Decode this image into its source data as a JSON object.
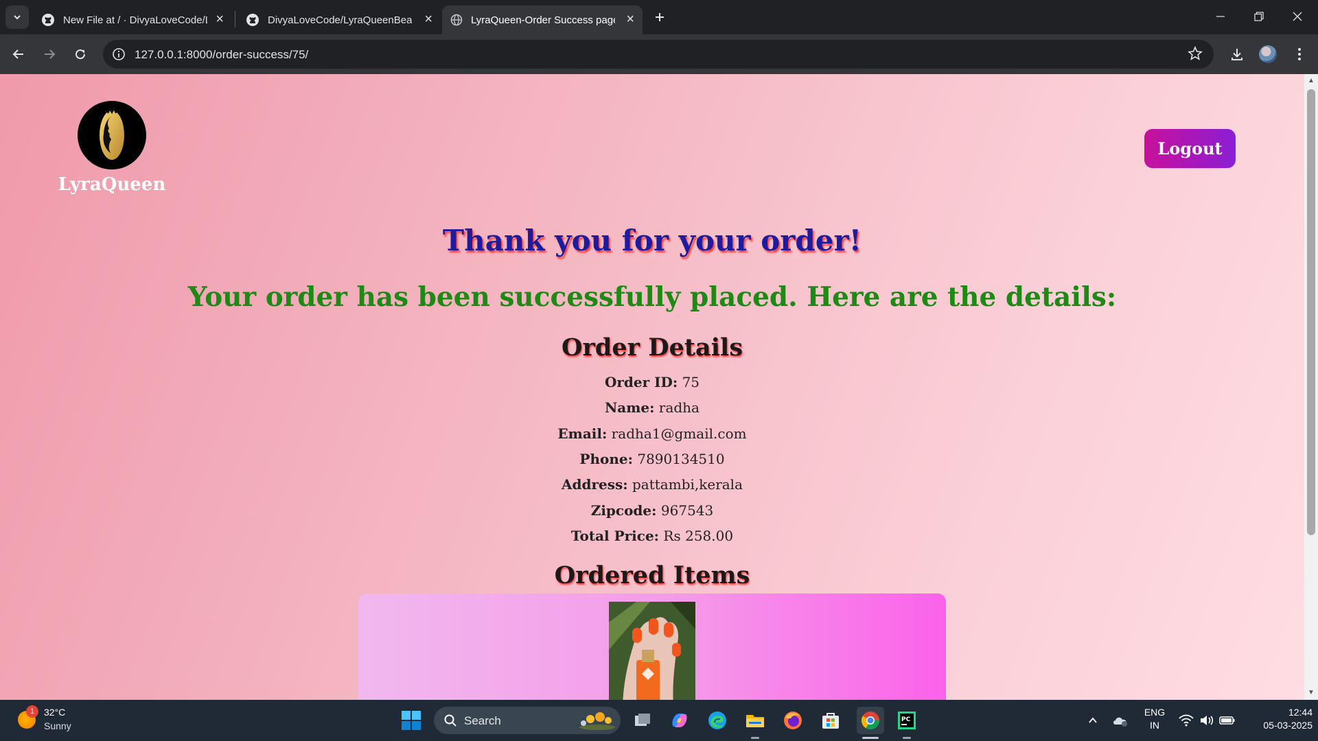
{
  "browser": {
    "tabs": [
      {
        "title": "New File at / · DivyaLoveCode/LyraQueenBeauty",
        "icon": "github-icon"
      },
      {
        "title": "DivyaLoveCode/LyraQueenBeauty",
        "icon": "github-icon"
      },
      {
        "title": "LyraQueen-Order Success page",
        "icon": "globe-icon",
        "active": true
      }
    ],
    "url": "127.0.0.1:8000/order-success/75/"
  },
  "page": {
    "brand": "LyraQueen",
    "logout_label": "Logout",
    "thank_you": "Thank you for your order!",
    "success_message": "Your order has been successfully placed. Here are the details:",
    "order_details_title": "Order Details",
    "details": [
      {
        "label": "Order ID:",
        "value": " 75"
      },
      {
        "label": "Name:",
        "value": " radha"
      },
      {
        "label": "Email:",
        "value": " radha1@gmail.com"
      },
      {
        "label": "Phone:",
        "value": " 7890134510"
      },
      {
        "label": "Address:",
        "value": " pattambi,kerala"
      },
      {
        "label": "Zipcode:",
        "value": " 967543"
      },
      {
        "label": "Total Price:",
        "value": " Rs 258.00"
      }
    ],
    "ordered_items_title": "Ordered Items"
  },
  "taskbar": {
    "weather": {
      "temp": "32°C",
      "desc": "Sunny",
      "badge": "1"
    },
    "search_label": "Search",
    "language": {
      "line1": "ENG",
      "line2": "IN"
    },
    "clock": {
      "time": "12:44",
      "date": "05-03-2025"
    }
  },
  "colors": {
    "accent_logout_start": "#c8109b",
    "accent_logout_end": "#8b1fd4",
    "thank_you": "#1c1ca0",
    "success": "#1d8a14"
  }
}
